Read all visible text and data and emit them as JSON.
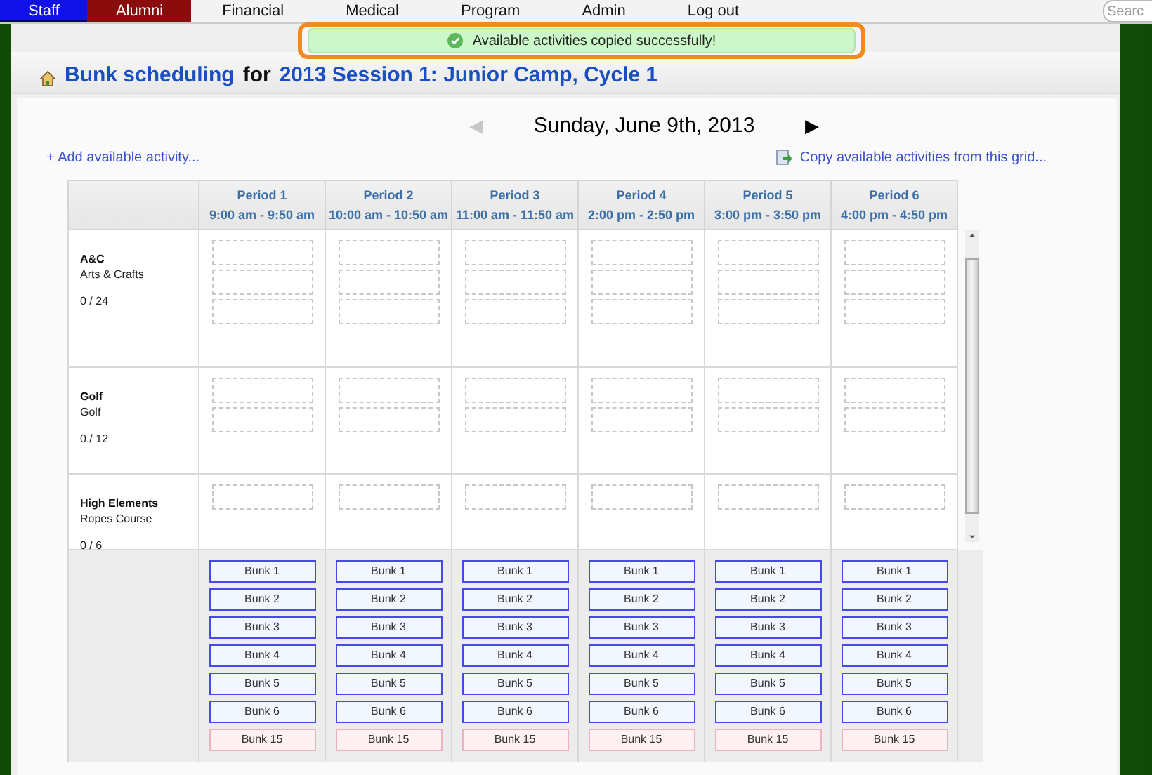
{
  "nav": {
    "items": [
      {
        "label": "Staff",
        "selected": true,
        "kind": "blue"
      },
      {
        "label": "Alumni",
        "selected": false,
        "kind": "red"
      },
      {
        "label": "Financial",
        "selected": false,
        "kind": "plain"
      },
      {
        "label": "Medical",
        "selected": false,
        "kind": "plain"
      },
      {
        "label": "Program",
        "selected": false,
        "kind": "plain"
      },
      {
        "label": "Admin",
        "selected": false,
        "kind": "plain"
      },
      {
        "label": "Log out",
        "selected": false,
        "kind": "plain"
      }
    ],
    "search": {
      "placeholder": "Searc"
    }
  },
  "toast": {
    "message": "Available activities copied successfully!"
  },
  "title": {
    "link": "Bunk scheduling",
    "joiner": "for",
    "session": "2013 Session 1: Junior Camp, Cycle 1"
  },
  "date_nav": {
    "date": "Sunday, June 9th, 2013",
    "prev": {
      "label": "◀",
      "disabled": true
    },
    "next": {
      "label": "▶",
      "disabled": false
    }
  },
  "actions": {
    "add": "+ Add available activity...",
    "copy": "Copy available activities from this grid..."
  },
  "periods": [
    {
      "name": "Period 1",
      "time": "9:00 am - 9:50 am",
      "bunks": [
        {
          "label": "Bunk 1",
          "kind": "assigned"
        },
        {
          "label": "Bunk 2",
          "kind": "assigned"
        },
        {
          "label": "Bunk 3",
          "kind": "assigned"
        },
        {
          "label": "Bunk 4",
          "kind": "assigned"
        },
        {
          "label": "Bunk 5",
          "kind": "assigned"
        },
        {
          "label": "Bunk 6",
          "kind": "assigned"
        },
        {
          "label": "Bunk 15",
          "kind": "unassigned"
        }
      ]
    },
    {
      "name": "Period 2",
      "time": "10:00 am - 10:50 am",
      "bunks": [
        {
          "label": "Bunk 1",
          "kind": "assigned"
        },
        {
          "label": "Bunk 2",
          "kind": "assigned"
        },
        {
          "label": "Bunk 3",
          "kind": "assigned"
        },
        {
          "label": "Bunk 4",
          "kind": "assigned"
        },
        {
          "label": "Bunk 5",
          "kind": "assigned"
        },
        {
          "label": "Bunk 6",
          "kind": "assigned"
        },
        {
          "label": "Bunk 15",
          "kind": "unassigned"
        }
      ]
    },
    {
      "name": "Period 3",
      "time": "11:00 am - 11:50 am",
      "bunks": [
        {
          "label": "Bunk 1",
          "kind": "assigned"
        },
        {
          "label": "Bunk 2",
          "kind": "assigned"
        },
        {
          "label": "Bunk 3",
          "kind": "assigned"
        },
        {
          "label": "Bunk 4",
          "kind": "assigned"
        },
        {
          "label": "Bunk 5",
          "kind": "assigned"
        },
        {
          "label": "Bunk 6",
          "kind": "assigned"
        },
        {
          "label": "Bunk 15",
          "kind": "unassigned"
        }
      ]
    },
    {
      "name": "Period 4",
      "time": "2:00 pm - 2:50 pm",
      "bunks": [
        {
          "label": "Bunk 1",
          "kind": "assigned"
        },
        {
          "label": "Bunk 2",
          "kind": "assigned"
        },
        {
          "label": "Bunk 3",
          "kind": "assigned"
        },
        {
          "label": "Bunk 4",
          "kind": "assigned"
        },
        {
          "label": "Bunk 5",
          "kind": "assigned"
        },
        {
          "label": "Bunk 6",
          "kind": "assigned"
        },
        {
          "label": "Bunk 15",
          "kind": "unassigned"
        }
      ]
    },
    {
      "name": "Period 5",
      "time": "3:00 pm - 3:50 pm",
      "bunks": [
        {
          "label": "Bunk 1",
          "kind": "assigned"
        },
        {
          "label": "Bunk 2",
          "kind": "assigned"
        },
        {
          "label": "Bunk 3",
          "kind": "assigned"
        },
        {
          "label": "Bunk 4",
          "kind": "assigned"
        },
        {
          "label": "Bunk 5",
          "kind": "assigned"
        },
        {
          "label": "Bunk 6",
          "kind": "assigned"
        },
        {
          "label": "Bunk 15",
          "kind": "unassigned"
        }
      ]
    },
    {
      "name": "Period 6",
      "time": "4:00 pm - 4:50 pm",
      "bunks": [
        {
          "label": "Bunk 1",
          "kind": "assigned"
        },
        {
          "label": "Bunk 2",
          "kind": "assigned"
        },
        {
          "label": "Bunk 3",
          "kind": "assigned"
        },
        {
          "label": "Bunk 4",
          "kind": "assigned"
        },
        {
          "label": "Bunk 5",
          "kind": "assigned"
        },
        {
          "label": "Bunk 6",
          "kind": "assigned"
        },
        {
          "label": "Bunk 15",
          "kind": "unassigned"
        }
      ]
    }
  ],
  "activities": [
    {
      "code": "A&C",
      "name": "Arts & Crafts",
      "count": "0 / 24",
      "slots": [
        {
          "kind": "empty"
        },
        {
          "kind": "empty"
        },
        {
          "kind": "empty"
        }
      ]
    },
    {
      "code": "Golf",
      "name": "Golf",
      "count": "0 / 12",
      "slots": [
        {
          "kind": "empty"
        },
        {
          "kind": "empty"
        }
      ]
    },
    {
      "code": "High Elements",
      "name": "Ropes Course",
      "count": "0 / 6",
      "slots": [
        {
          "kind": "empty"
        }
      ]
    }
  ]
}
